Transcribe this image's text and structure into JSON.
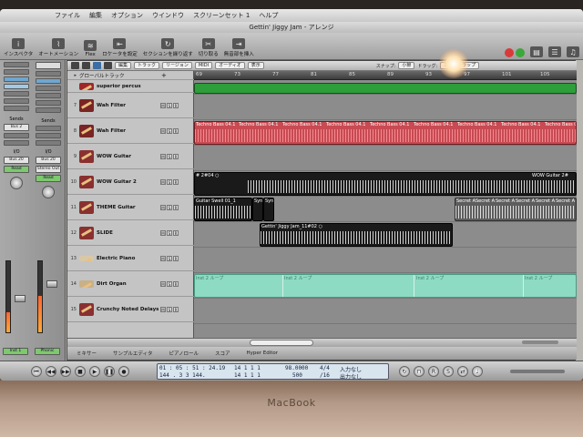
{
  "window": {
    "title": "Gettin' Jiggy Jam - アレンジ"
  },
  "menubar": [
    "ファイル",
    "編集",
    "オプション",
    "ウインドウ",
    "スクリーンセット 1",
    "ヘルプ"
  ],
  "toolbar": {
    "buttons": [
      "インスペクタ",
      "オートメーション",
      "Flex",
      "ロケータを設定",
      "セクションを繰り返す",
      "切り取る",
      "無音部を挿入"
    ],
    "colors_icon": "colors-icon"
  },
  "arrange_menu": {
    "items": [
      "編集",
      "トラック",
      "リージョン",
      "MIDI",
      "オーディオ",
      "表示"
    ],
    "snap_label": "スナップ:",
    "snap_value": "小節",
    "drag_label": "ドラッグ:",
    "drag_value": "オーバーラップ"
  },
  "ruler": {
    "marks": [
      "69",
      "73",
      "77",
      "81",
      "85",
      "89",
      "93",
      "97",
      "101",
      "105"
    ]
  },
  "tracks": [
    {
      "num": "",
      "name": "グローバルトラック"
    },
    {
      "num": "",
      "name": "superior percus"
    },
    {
      "num": "7",
      "name": "Wah Filter"
    },
    {
      "num": "8",
      "name": "Wah Filter"
    },
    {
      "num": "9",
      "name": "WOW Guitar"
    },
    {
      "num": "10",
      "name": "WOW Guitar 2"
    },
    {
      "num": "11",
      "name": "THEME Guitar"
    },
    {
      "num": "12",
      "name": "SLIDE"
    },
    {
      "num": "13",
      "name": "Electric Piano"
    },
    {
      "num": "14",
      "name": "Dirt Organ"
    },
    {
      "num": "15",
      "name": "Crunchy Noted Delays"
    }
  ],
  "regions": {
    "techno": "Techno Bass 04.1",
    "wow_left": "# 2#04 ○",
    "wow_right": "WOW Guitar 2#",
    "guitar_swell": "Guitar Swell 01_1",
    "syn": "Syn",
    "secret": "Secret A",
    "gettin": "Gettin' Jiggy Jam_11#02 ○",
    "loop": "Inst 2 ループ"
  },
  "mixer": {
    "strip1": {
      "io": "Bus 2",
      "out": "Bus 20",
      "mode": "Read",
      "label": "Inst 1"
    },
    "strip2": {
      "io": "Bus 20",
      "out": "Stereo Out",
      "mode": "Read",
      "label": "Phonic"
    },
    "sends_label": "Sends",
    "io_label": "I/O"
  },
  "editor_tabs": [
    "ミキサー",
    "サンプルエディタ",
    "ピアノロール",
    "スコア",
    "Hyper Editor"
  ],
  "transport": {
    "smpte": "01 : 05 : 51 : 24.19",
    "bars": "144 .  3  3  144.",
    "pos1": "14    1    1    1",
    "pos2": "14    1    1    1",
    "tempo": "98.0000",
    "tempo2": "500",
    "sig": "4/4",
    "div": "/16",
    "in_label": "入力なし",
    "out_label": "出力なし"
  },
  "footer": {
    "brand": "MacBook"
  }
}
